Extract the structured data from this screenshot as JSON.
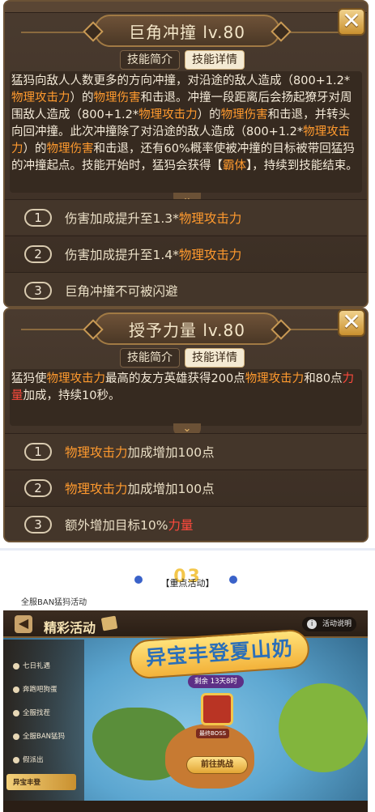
{
  "panels": [
    {
      "title": "巨角冲撞 lv.80",
      "tabs": [
        "技能简介",
        "技能详情"
      ],
      "active_tab": "技能详情",
      "description": [
        {
          "t": "猛犸向敌人人数更多的方向冲撞，对沿途的敌人造成（800+1.2*"
        },
        {
          "t": "物理攻击力",
          "c": "o"
        },
        {
          "t": "）的"
        },
        {
          "t": "物理伤害",
          "c": "o"
        },
        {
          "t": "和击退。冲撞一段距离后会扬起獠牙对周围敌人造成（800+1.2*"
        },
        {
          "t": "物理攻击力",
          "c": "o"
        },
        {
          "t": "）的"
        },
        {
          "t": "物理伤害",
          "c": "o"
        },
        {
          "t": "和击退，并转头向回冲撞。此次冲撞除了对沿途的敌人造成（800+1.2*"
        },
        {
          "t": "物理攻击力",
          "c": "o"
        },
        {
          "t": "）的"
        },
        {
          "t": "物理伤害",
          "c": "o"
        },
        {
          "t": "和击退，还有60%概率使被冲撞的目标被带回猛犸的冲撞起点。技能开始时，猛犸会获得【"
        },
        {
          "t": "霸体",
          "c": "o"
        },
        {
          "t": "】，持续到技能结束。"
        }
      ],
      "upgrades": [
        {
          "num": "1",
          "parts": [
            {
              "t": "伤害加成提升至1.3*"
            },
            {
              "t": "物理攻击力",
              "c": "o"
            }
          ]
        },
        {
          "num": "2",
          "parts": [
            {
              "t": "伤害加成提升至1.4*"
            },
            {
              "t": "物理攻击力",
              "c": "o"
            }
          ]
        },
        {
          "num": "3",
          "parts": [
            {
              "t": "巨角冲撞不可被闪避"
            }
          ]
        }
      ]
    },
    {
      "title": "授予力量 lv.80",
      "tabs": [
        "技能简介",
        "技能详情"
      ],
      "active_tab": "技能详情",
      "description": [
        {
          "t": "猛犸使"
        },
        {
          "t": "物理攻击力",
          "c": "o"
        },
        {
          "t": "最高的友方英雄获得200点"
        },
        {
          "t": "物理攻击力",
          "c": "o"
        },
        {
          "t": "和80点"
        },
        {
          "t": "力量",
          "c": "r"
        },
        {
          "t": "加成，持续10秒。"
        }
      ],
      "upgrades": [
        {
          "num": "1",
          "parts": [
            {
              "t": "物理攻击力",
              "c": "o"
            },
            {
              "t": "加成增加100点"
            }
          ]
        },
        {
          "num": "2",
          "parts": [
            {
              "t": "物理攻击力",
              "c": "o"
            },
            {
              "t": "加成增加100点"
            }
          ]
        },
        {
          "num": "3",
          "parts": [
            {
              "t": "额外增加目标10%"
            },
            {
              "t": "力量",
              "c": "r"
            }
          ]
        }
      ]
    }
  ],
  "section": {
    "number": "03",
    "label": "【重点活动】",
    "caption": "全服BAN猛犸活动"
  },
  "game": {
    "title": "精彩活动",
    "info_label": "活动说明",
    "info_icon": "i",
    "back_icon": "◀",
    "sidebar": [
      "七日礼遇",
      "奔跑吧狗蛋",
      "全服找茬",
      "全服BAN猛犸",
      "假派出",
      "异宝丰登"
    ],
    "active_item": "异宝丰登",
    "banner": "异宝丰登夏山奶",
    "remaining": "剩余 13天8时",
    "boss_label": "最终BOSS",
    "go_button": "前往挑战"
  }
}
